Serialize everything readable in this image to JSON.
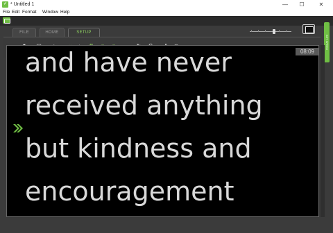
{
  "window": {
    "title": "* Untitled 1",
    "minimize_glyph": "—",
    "maximize_glyph": "☐",
    "close_glyph": "✕"
  },
  "menu": [
    "File",
    "Edit",
    "Format",
    "Window",
    "Help"
  ],
  "tabs": [
    {
      "label": "FILE",
      "active": false
    },
    {
      "label": "HOME",
      "active": false
    },
    {
      "label": "SETUP",
      "active": true
    }
  ],
  "toolbar": {
    "tools": [
      {
        "icon": "monitor-icon",
        "glyph": "▬"
      },
      {
        "icon": "document-icon",
        "glyph": "▮"
      },
      {
        "icon": "page-list-icon",
        "glyph": "▤"
      },
      {
        "icon": "arrow-right-icon",
        "glyph": "➜"
      },
      {
        "icon": "export-green-icon",
        "glyph": "⇥"
      },
      {
        "icon": "mirror-icon",
        "glyph": "⇋"
      },
      {
        "icon": "flip-green-icon",
        "glyph": "⇅"
      },
      {
        "icon": "green-square-icon",
        "glyph": "■"
      },
      {
        "icon": "green-rect-icon",
        "glyph": "■"
      },
      {
        "icon": "clock-green-icon",
        "glyph": "◔"
      },
      {
        "icon": "loop-icon",
        "glyph": "↻"
      },
      {
        "icon": "cue-text-icon",
        "glyph": "C"
      },
      {
        "icon": "font-color-icon",
        "glyph": "A"
      },
      {
        "icon": "disk-icon",
        "glyph": "◉"
      }
    ],
    "speed_level": 0.55
  },
  "side_tab_label": "SET SPEED",
  "stage": {
    "timer": "08:09",
    "lines": [
      "and have never",
      "received anything",
      "but kindness and",
      "encouragement"
    ],
    "cue_color": "#6fbe44",
    "text_color": "#d9d9d9",
    "background": "#000000"
  },
  "colors": {
    "accent": "#6fbe44",
    "chrome": "#3b3b3b"
  }
}
